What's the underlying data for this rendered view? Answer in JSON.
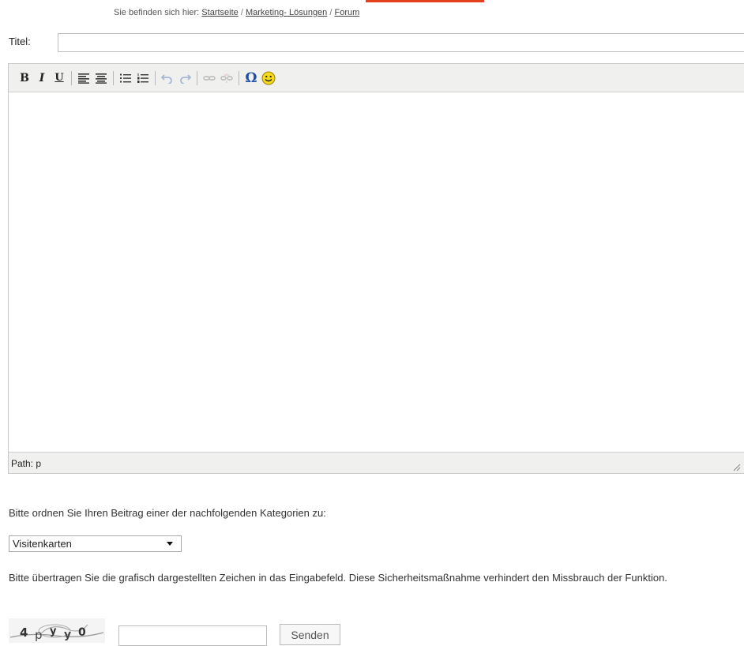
{
  "breadcrumb": {
    "prefix": "Sie befinden sich hier:",
    "items": [
      "Startseite",
      "Marketing- Lösungen",
      "Forum"
    ],
    "separator": "/"
  },
  "form": {
    "title_label": "Titel:",
    "title_value": ""
  },
  "editor": {
    "toolbar": {
      "bold": "B",
      "italic": "I",
      "underline": "U",
      "special_char": "Ω",
      "buttons": [
        "bold-icon",
        "italic-icon",
        "underline-icon",
        "align-left-icon",
        "align-center-icon",
        "bullet-list-icon",
        "numbered-list-icon",
        "undo-icon",
        "redo-icon",
        "link-icon",
        "unlink-icon",
        "special-char-icon",
        "smiley-icon"
      ]
    },
    "content": "",
    "status": "Path: p"
  },
  "category": {
    "prompt": "Bitte ordnen Sie Ihren Beitrag einer der nachfolgenden Kategorien zu:",
    "selected": "Visitenkarten"
  },
  "captcha": {
    "instructions": "Bitte übertragen Sie die grafisch dargestellten Zeichen in das Eingabefeld. Diese Sicherheitsmaßnahme verhindert den Missbrauch der Funktion.",
    "image_text": "4pyy0",
    "input_value": "",
    "submit_label": "Senden"
  },
  "colors": {
    "accent": "#e4401c",
    "toolbar_bg": "#f0f0ee",
    "omega": "#1e4fa8",
    "smiley": "#f4d91c"
  }
}
